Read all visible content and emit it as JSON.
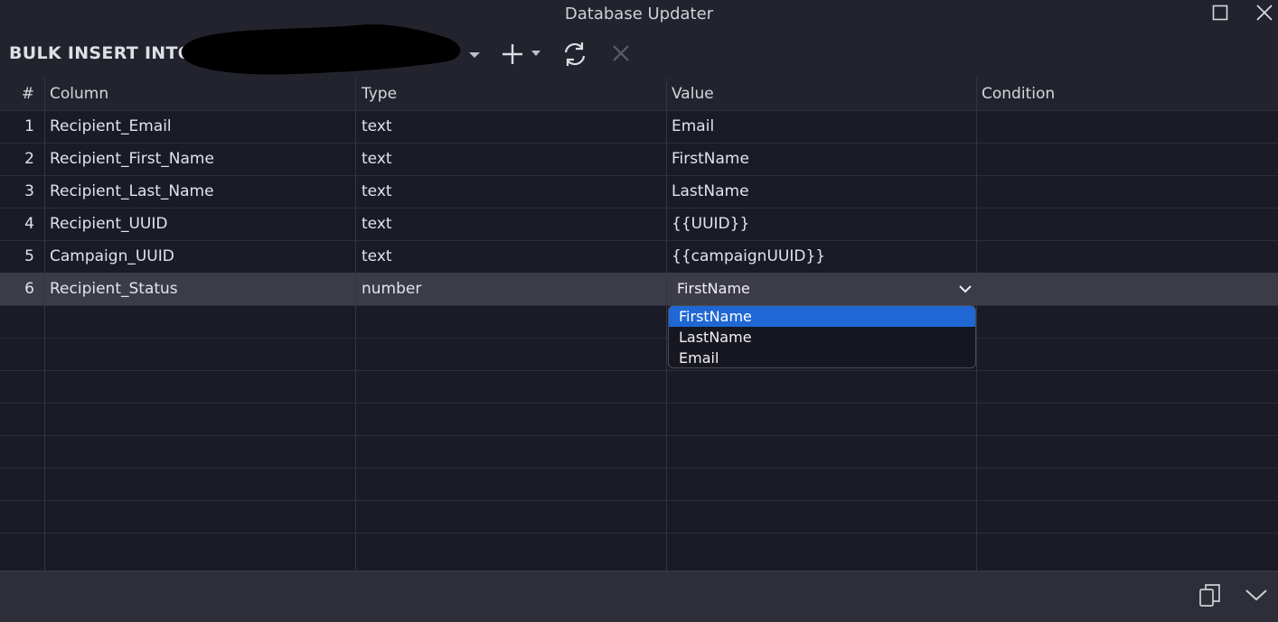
{
  "window": {
    "title": "Database Updater"
  },
  "toolbar": {
    "mode_label": "BULK INSERT INTO",
    "table_name_redacted": true
  },
  "grid": {
    "headers": {
      "num": "#",
      "column": "Column",
      "type": "Type",
      "value": "Value",
      "condition": "Condition"
    },
    "rows": [
      {
        "num": "1",
        "column": "Recipient_Email",
        "type": "text",
        "value": "Email",
        "condition": ""
      },
      {
        "num": "2",
        "column": "Recipient_First_Name",
        "type": "text",
        "value": "FirstName",
        "condition": ""
      },
      {
        "num": "3",
        "column": "Recipient_Last_Name",
        "type": "text",
        "value": "LastName",
        "condition": ""
      },
      {
        "num": "4",
        "column": "Recipient_UUID",
        "type": "text",
        "value": "{{UUID}}",
        "condition": ""
      },
      {
        "num": "5",
        "column": "Campaign_UUID",
        "type": "text",
        "value": "{{campaignUUID}}",
        "condition": ""
      },
      {
        "num": "6",
        "column": "Recipient_Status",
        "type": "number",
        "value": "FirstName",
        "condition": ""
      }
    ],
    "selected_row": 6,
    "empty_rows": 8
  },
  "value_dropdown": {
    "selected": "FirstName",
    "options": [
      "FirstName",
      "LastName",
      "Email"
    ],
    "highlighted_index": 0
  },
  "colors": {
    "background": "#1a1b26",
    "selected_row": "#3b3c47",
    "highlight": "#1f67d4"
  },
  "icons": {
    "maximize": "maximize-icon",
    "close": "close-icon",
    "add": "plus-icon",
    "refresh": "refresh-icon",
    "cancel": "cancel-icon",
    "copy": "copy-icon",
    "collapse": "chevron-down-icon"
  }
}
